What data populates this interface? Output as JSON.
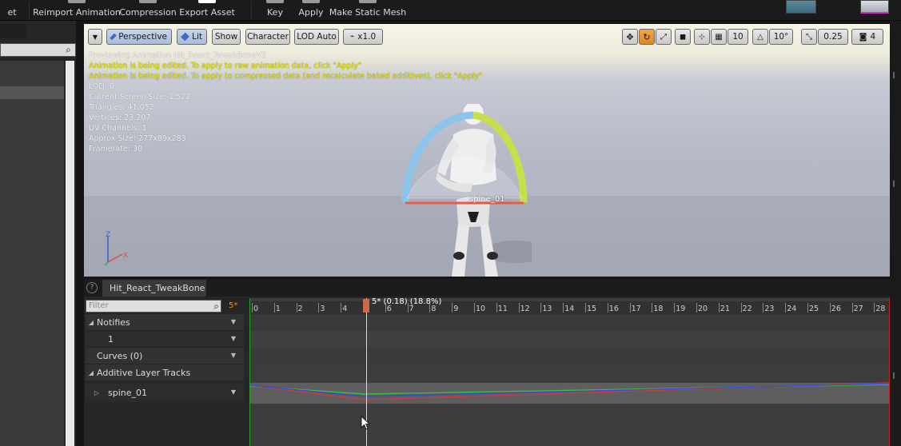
{
  "toolbar": {
    "cutoff_label": "et",
    "reimport_label": "Reimport Animation",
    "compression_label": "Compression",
    "export_label": "Export Asset",
    "key_label": "Key",
    "apply_label": "Apply",
    "make_static_mesh_label": "Make Static Mesh"
  },
  "viewport": {
    "perspective_label": "Perspective",
    "lit_label": "Lit",
    "show_label": "Show",
    "character_label": "Character",
    "lod_label": "LOD Auto",
    "speed_label": "x1.0",
    "grid_snap_value": "10",
    "rotation_snap_value": "10°",
    "scale_snap_value": "0.25",
    "camera_speed_value": "4",
    "info_lines": {
      "previewing": "Previewing Animation Hit_React_TweakBoneV2",
      "warn_raw": "Animation is being edited. To apply to raw animation data, click \"Apply\"",
      "warn_compressed": "Animation is being edited. To apply to compressed data (and recalculate baked additives), click \"Apply\"",
      "lod": "LOD: 0",
      "screen_size": "Current Screen Size: 1.522",
      "triangles": "Triangles: 41,052",
      "vertices": "Vertices: 23,207",
      "uv_channels": "UV Channels: 1",
      "approx_size": "Approx Size: 277x89x283",
      "framerate": "Framerate: 30"
    },
    "bone_label": "spine_01",
    "axis_z": "Z",
    "axis_x": "X"
  },
  "sequencer": {
    "tab_label": "Hit_React_TweakBone",
    "filter_placeholder": "Filter",
    "frame_indicator": "5*",
    "playhead_label": "5* (0.18) (18.8%)",
    "tracks": {
      "notifies": "Notifies",
      "notify_track": "1",
      "curves": "Curves  (0)",
      "additive": "Additive Layer Tracks",
      "spine": "spine_01"
    },
    "ruler_ticks": [
      "0",
      "1",
      "2",
      "3",
      "4",
      "5",
      "6",
      "7",
      "8",
      "9",
      "10",
      "11",
      "12",
      "13",
      "14",
      "15",
      "16",
      "17",
      "18",
      "19",
      "20",
      "21",
      "22",
      "23",
      "24",
      "25",
      "26",
      "27",
      "28"
    ],
    "playhead_frame": 5,
    "curve_colors": {
      "red": "#d03a3a",
      "green": "#3ac03a",
      "blue": "#3a4ad8"
    }
  }
}
